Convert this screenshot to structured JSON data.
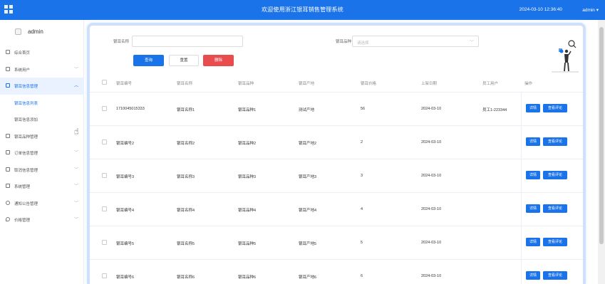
{
  "header": {
    "title": "欢迎使用浙江银耳销售管理系统",
    "datetime": "2024-03-10 12:36:40",
    "user": "admin ▾"
  },
  "sidebar": {
    "username": "admin",
    "items": [
      {
        "label": "综合首页",
        "chevron": ""
      },
      {
        "label": "系统用户",
        "chevron": "﹀"
      },
      {
        "label": "银耳信息管理",
        "chevron": "︿"
      },
      {
        "label": "银耳信息列表",
        "chevron": ""
      },
      {
        "label": "银耳信息添加",
        "chevron": ""
      },
      {
        "label": "银耳品种管理",
        "chevron": "﹀"
      },
      {
        "label": "订单信息管理",
        "chevron": "﹀"
      },
      {
        "label": "取消信息管理",
        "chevron": "﹀"
      },
      {
        "label": "系统管理",
        "chevron": "﹀"
      },
      {
        "label": "通知公告管理",
        "chevron": "﹀"
      },
      {
        "label": "价格管理",
        "chevron": "﹀"
      }
    ]
  },
  "search": {
    "name_label": "银耳名称",
    "name_value": "",
    "type_label": "银耳品种",
    "type_placeholder": "请选择",
    "type_chevron": "﹀",
    "query_btn": "查询",
    "reset_btn": "重置",
    "delete_btn": "删除"
  },
  "table": {
    "headers": [
      "银耳编号",
      "银耳名称",
      "银耳品种",
      "银耳产地",
      "银耳价格",
      "上架日期",
      "员工用户",
      "操作"
    ],
    "rows": [
      {
        "id": "1710045015333",
        "name": "银耳名称1",
        "variety": "银耳品种1",
        "origin": "测试产地",
        "price": "56",
        "date": "2024-03-10",
        "staff": "员工1-223344",
        "btn1": "详情",
        "btn2": "查看评论"
      },
      {
        "id": "银耳编号2",
        "name": "银耳名称2",
        "variety": "银耳品种2",
        "origin": "银耳产地2",
        "price": "2",
        "date": "2024-03-10",
        "staff": "",
        "btn1": "详情",
        "btn2": "查看评论"
      },
      {
        "id": "银耳编号3",
        "name": "银耳名称3",
        "variety": "银耳品种3",
        "origin": "银耳产地3",
        "price": "3",
        "date": "2024-03-10",
        "staff": "",
        "btn1": "详情",
        "btn2": "查看评论"
      },
      {
        "id": "银耳编号4",
        "name": "银耳名称4",
        "variety": "银耳品种4",
        "origin": "银耳产地4",
        "price": "4",
        "date": "2024-03-10",
        "staff": "",
        "btn1": "详情",
        "btn2": "查看评论"
      },
      {
        "id": "银耳编号5",
        "name": "银耳名称5",
        "variety": "银耳品种5",
        "origin": "银耳产地5",
        "price": "5",
        "date": "2024-03-10",
        "staff": "",
        "btn1": "详情",
        "btn2": "查看评论"
      },
      {
        "id": "银耳编号6",
        "name": "银耳名称6",
        "variety": "银耳品种6",
        "origin": "银耳产地6",
        "price": "6",
        "date": "2024-03-10",
        "staff": "",
        "btn1": "详情",
        "btn2": "查看评论"
      }
    ]
  },
  "colors": {
    "primary": "#1a73e8",
    "danger": "#e84c4c",
    "frame": "#cfe0fb"
  }
}
